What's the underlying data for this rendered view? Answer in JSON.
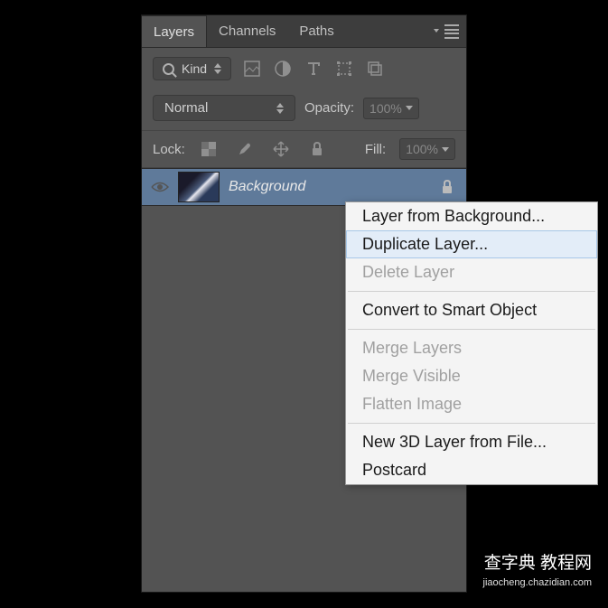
{
  "tabs": [
    "Layers",
    "Channels",
    "Paths"
  ],
  "activeTab": 0,
  "filter": {
    "label": "Kind"
  },
  "blendMode": "Normal",
  "opacity": {
    "label": "Opacity:",
    "value": "100%"
  },
  "lock": {
    "label": "Lock:"
  },
  "fill": {
    "label": "Fill:",
    "value": "100%"
  },
  "layer": {
    "name": "Background"
  },
  "contextMenu": {
    "items": [
      {
        "label": "Layer from Background...",
        "disabled": false
      },
      {
        "label": "Duplicate Layer...",
        "disabled": false,
        "highlighted": true
      },
      {
        "label": "Delete Layer",
        "disabled": true
      },
      {
        "label": "Convert to Smart Object",
        "disabled": false,
        "sep_before": true
      },
      {
        "label": "Merge Layers",
        "disabled": true,
        "sep_before": true
      },
      {
        "label": "Merge Visible",
        "disabled": true
      },
      {
        "label": "Flatten Image",
        "disabled": true
      },
      {
        "label": "New 3D Layer from File...",
        "disabled": false,
        "sep_before": true
      },
      {
        "label": "Postcard",
        "disabled": false
      }
    ]
  },
  "watermark": {
    "main": "查字典 教程网",
    "sub": "jiaocheng.chazidian.com"
  }
}
